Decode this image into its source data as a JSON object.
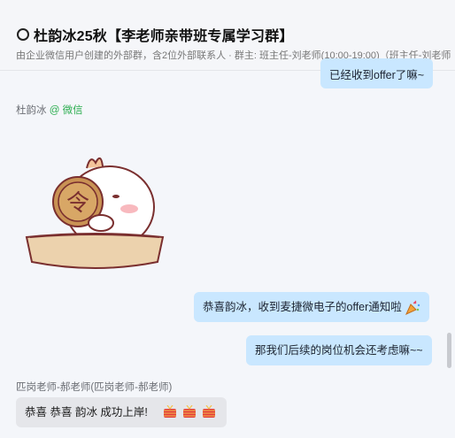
{
  "header": {
    "title": "杜韵冰25秋【李老师亲带班专属学习群】",
    "subtitle": "由企业微信用户创建的外部群，含2位外部联系人 · 群主: 班主任-刘老师(10:00-19:00)（班主任-刘老师（"
  },
  "messages": [
    {
      "side": "mine",
      "text": "已经收到offer了嘛~"
    },
    {
      "side": "theirs",
      "sender": "杜韵冰",
      "sender_source": "@ 微信",
      "type": "sticker"
    },
    {
      "side": "mine",
      "text": "恭喜韵冰，收到麦捷微电子的offer通知啦",
      "emoji": "party-popper-icon"
    },
    {
      "side": "mine",
      "text": "那我们后续的岗位机会还考虑嘛~~"
    },
    {
      "side": "theirs",
      "sender": "匹岗老师-郝老师(匹岗老师-郝老师)",
      "text": "恭喜   恭喜    韵冰 成功上岸!",
      "emoji": "firecracker-icon"
    }
  ],
  "colors": {
    "mine_bubble": "#c9e7ff",
    "theirs_bubble": "#e5e6ea",
    "wechat_green": "#2bad4f"
  }
}
